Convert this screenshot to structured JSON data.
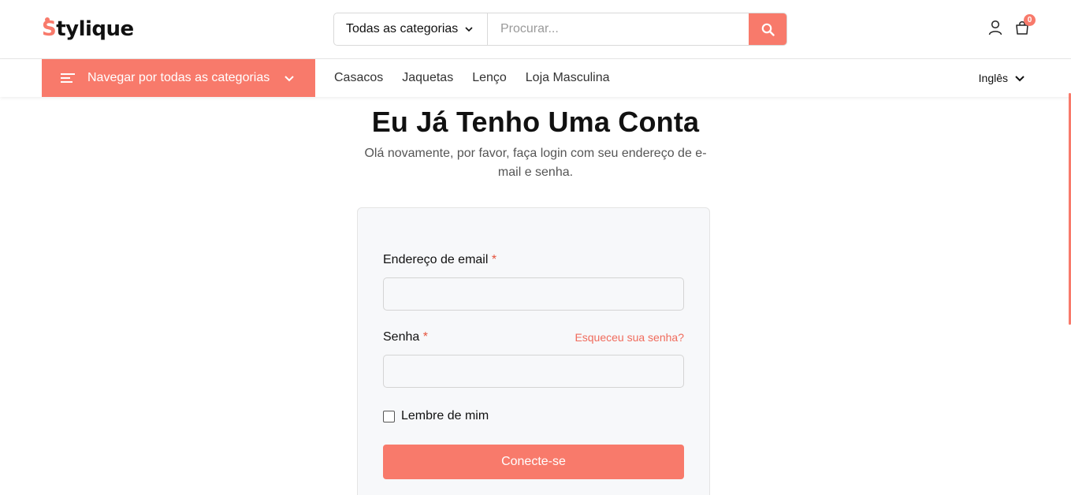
{
  "brand": {
    "logo_text_s": "S",
    "logo_text_rest": "tylique",
    "accent_color": "#f87a6b"
  },
  "search": {
    "category_label": "Todas as categorias",
    "placeholder": "Procurar...",
    "value": ""
  },
  "header_icons": {
    "user_icon": "user-icon",
    "cart_icon": "shopping-bag-icon",
    "cart_count": "0"
  },
  "nav": {
    "browse_label": "Navegar por todas as categorias",
    "links": [
      "Casacos",
      "Jaquetas",
      "Lenço",
      "Loja Masculina"
    ],
    "language": "Inglês"
  },
  "login": {
    "title": "Eu Já Tenho Uma Conta",
    "subtitle": "Olá novamente, por favor, faça login com seu endereço de e-mail e senha.",
    "email_label": "Endereço de email",
    "password_label": "Senha",
    "required_mark": "*",
    "forgot_label": "Esqueceu sua senha?",
    "remember_label": "Lembre de mim",
    "submit_label": "Conecte-se",
    "email_value": "",
    "password_value": ""
  }
}
